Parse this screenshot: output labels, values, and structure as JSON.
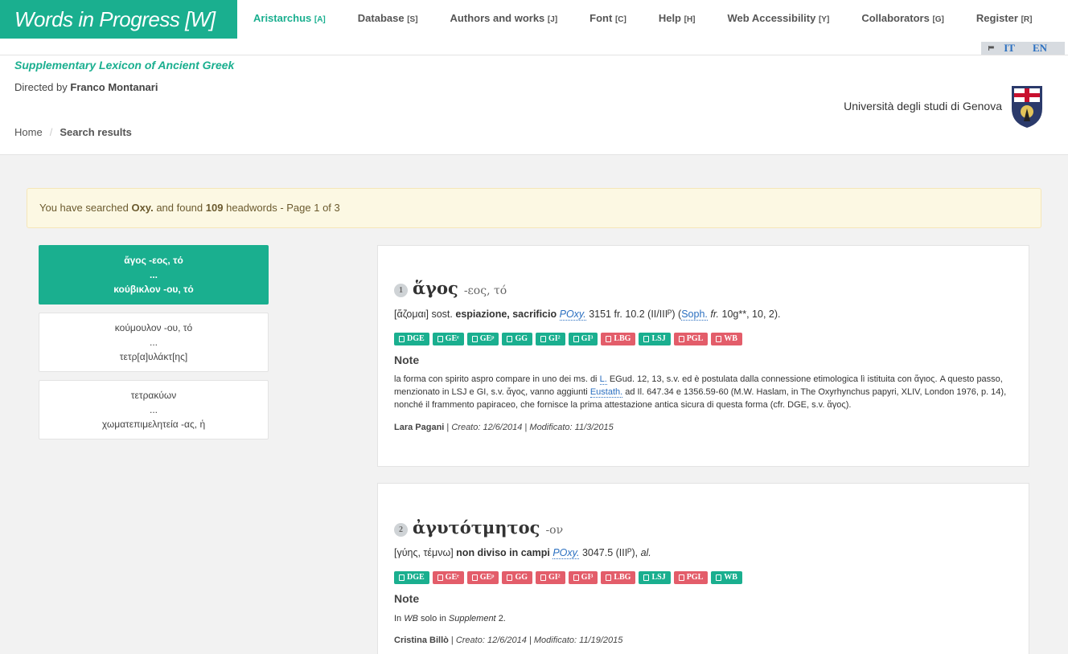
{
  "nav": {
    "brand": "Words in Progress [W]",
    "items": [
      {
        "label": "Aristarchus",
        "key": "[A]"
      },
      {
        "label": "Database",
        "key": "[S]"
      },
      {
        "label": "Authors and works",
        "key": "[J]"
      },
      {
        "label": "Font",
        "key": "[C]"
      },
      {
        "label": "Help",
        "key": "[H]"
      },
      {
        "label": "Web Accessibility",
        "key": "[Y]"
      },
      {
        "label": "Collaborators",
        "key": "[G]"
      },
      {
        "label": "Register",
        "key": "[R]"
      }
    ],
    "lang_it": "IT",
    "lang_en": "EN"
  },
  "header": {
    "lexicon_title": "Supplementary Lexicon of Ancient Greek",
    "directed_prefix": "Directed by",
    "director": "Franco Montanari",
    "university": "Università degli studi di Genova"
  },
  "breadcrumb": {
    "home": "Home",
    "sep": "/",
    "current": "Search results"
  },
  "alert": {
    "prefix": "You have searched",
    "query": "Oxy.",
    "middle": "and found",
    "count": "109",
    "suffix": "headwords - Page 1 of 3"
  },
  "ranges": [
    {
      "from": "ἄγος -εος, τό",
      "dots": "...",
      "to": "κούβικλον -ου, τό"
    },
    {
      "from": "κούμουλον -ου, τό",
      "dots": "...",
      "to": "τετρ[α]υλάκτ[ης]"
    },
    {
      "from": "τετρακύων",
      "dots": "...",
      "to": "χωματεπιμελητεία -ας, ἡ"
    }
  ],
  "entries": [
    {
      "num": "1",
      "lemma": "ἅγος",
      "gram": "-εος, τό",
      "def_etym": "[ἅζομαι] sost.",
      "def_main": "espiazione, sacrificio",
      "def_src": "POxy.",
      "def_ref": "3151 fr. 10.2 (II/IIIᴾ) (",
      "def_src2": "Soph.",
      "def_fr": "fr.",
      "def_tail": "10g**, 10, 2).",
      "badges": [
        {
          "label": "DGE",
          "c": "g"
        },
        {
          "label": "GEᵉ",
          "c": "g"
        },
        {
          "label": "GEᵖ",
          "c": "g"
        },
        {
          "label": "GG",
          "c": "g"
        },
        {
          "label": "GI²",
          "c": "g"
        },
        {
          "label": "GI³",
          "c": "g"
        },
        {
          "label": "LBG",
          "c": "r"
        },
        {
          "label": "LSJ",
          "c": "g"
        },
        {
          "label": "PGL",
          "c": "r"
        },
        {
          "label": "WB",
          "c": "r"
        }
      ],
      "note_title": "Note",
      "note_1": "la forma con spirito aspro compare in uno dei ms. di",
      "note_ref1": "L.",
      "note_2": "EGud. 12, 13, s.v. ed è postulata dalla connessione etimologica lì istituita con ἅγιος. A questo passo, menzionato in LSJ e GI, s.v. ἄγος, vanno aggiunti",
      "note_ref2": "Eustath.",
      "note_3": "ad Il. 647.34 e 1356.59-60 (M.W. Haslam, in The Oxyrhynchus papyri, XLIV, London 1976, p. 14), nonché il frammento papiraceo, che fornisce la prima attestazione antica sicura di questa forma (cfr. DGE, s.v. ἅγος).",
      "author": "Lara Pagani",
      "created": "Creato: 12/6/2014",
      "modified": "Modificato: 11/3/2015"
    },
    {
      "num": "2",
      "lemma": "ἀγυτότμητος",
      "gram": "-ον",
      "def_etym": "[γύης, τέμνω]",
      "def_main": "non diviso in campi",
      "def_src": "POxy.",
      "def_ref": "3047.5 (IIIᴾ),",
      "def_al": "al.",
      "badges": [
        {
          "label": "DGE",
          "c": "g"
        },
        {
          "label": "GEᵉ",
          "c": "r"
        },
        {
          "label": "GEᵖ",
          "c": "r"
        },
        {
          "label": "GG",
          "c": "r"
        },
        {
          "label": "GI²",
          "c": "r"
        },
        {
          "label": "GI³",
          "c": "r"
        },
        {
          "label": "LBG",
          "c": "r"
        },
        {
          "label": "LSJ",
          "c": "g"
        },
        {
          "label": "PGL",
          "c": "r"
        },
        {
          "label": "WB",
          "c": "g"
        }
      ],
      "note_title": "Note",
      "note_a": "In",
      "note_wb": "WB",
      "note_b": "solo in",
      "note_supp": "Supplement",
      "note_c": "2.",
      "author": "Cristina Billò",
      "created": "Creato: 12/6/2014",
      "modified": "Modificato: 11/19/2015"
    }
  ]
}
